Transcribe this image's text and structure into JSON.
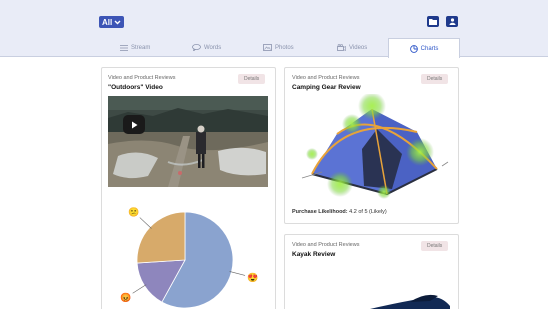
{
  "header": {
    "filter_label": "All",
    "icons": [
      "folder-icon",
      "user-icon"
    ]
  },
  "tabs": [
    {
      "label": "Stream",
      "icon": "list-icon"
    },
    {
      "label": "Words",
      "icon": "chat-bubble-icon"
    },
    {
      "label": "Photos",
      "icon": "photo-icon"
    },
    {
      "label": "Videos",
      "icon": "video-icon"
    },
    {
      "label": "Charts",
      "icon": "pie-chart-icon",
      "active": true
    }
  ],
  "cards": [
    {
      "category": "Video and Product Reviews",
      "title": "\"Outdoors\" Video",
      "details_label": "Details"
    },
    {
      "category": "Video and Product Reviews",
      "title": "Camping Gear Review",
      "details_label": "Details",
      "likelihood_label": "Purchase Likelihood:",
      "likelihood_value": "4.2 of 5 (Likely)"
    },
    {
      "category": "Video and Product Reviews",
      "title": "Kayak Review",
      "details_label": "Details"
    }
  ],
  "chart_data": {
    "type": "pie",
    "slices": [
      {
        "name": "happy",
        "value": 58,
        "color": "#8aa3cf",
        "emoji": "😍"
      },
      {
        "name": "angry",
        "value": 16,
        "color": "#8e86bd",
        "emoji": "😡"
      },
      {
        "name": "confused",
        "value": 26,
        "color": "#d7aa6a",
        "emoji": "😕"
      }
    ]
  },
  "colors": {
    "accent": "#3d55b6",
    "header_bg": "#e9ecf7",
    "active_tab": "#2f57c8"
  }
}
